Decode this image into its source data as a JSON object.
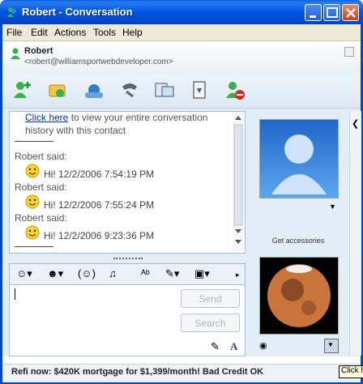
{
  "window": {
    "title": "Robert - Conversation",
    "controls": [
      "minimize",
      "maximize",
      "close"
    ]
  },
  "menu": {
    "items": [
      "File",
      "Edit",
      "Actions",
      "Tools",
      "Help"
    ]
  },
  "contact": {
    "name": "Robert",
    "email": "<robert@williamsportwebdeveloper.com>",
    "status_icon": "online-buddy-icon"
  },
  "toolbar": {
    "tools": [
      "invite-contact-icon",
      "send-files-icon",
      "start-call-icon",
      "call-phone-icon",
      "activities-icon",
      "games-icon",
      "block-contact-icon"
    ]
  },
  "conversation": {
    "history_link": "Click here",
    "history_text_1": "to view your entire conversation",
    "history_text_2": "history with this contact",
    "messages": [
      {
        "sender": "Robert said:",
        "text": "Hi! 12/2/2006 7:54:19 PM"
      },
      {
        "sender": "Robert said:",
        "text": "Hi! 12/2/2006 7:55:24 PM"
      },
      {
        "sender": "Robert said:",
        "text": "Hi! 12/2/2006 9:23:36 PM"
      }
    ]
  },
  "compose": {
    "send_label": "Send",
    "search_label": "Search",
    "emoticon_icons": [
      "emoticon-icon",
      "wink-icon",
      "nudge-icon",
      "voice-clip-icon",
      "font-icon",
      "color-icon",
      "background-icon"
    ]
  },
  "sidebar": {
    "get_accessories": "Get accessories"
  },
  "status_bar": {
    "ad_text": "Refi now: $420K mortgage for $1,399/month! Bad Credit OK",
    "tooltip": "Click h"
  },
  "colors": {
    "title_bar": "#0054e3",
    "link": "#0033cc",
    "panel_bg": "#e3edf6"
  }
}
